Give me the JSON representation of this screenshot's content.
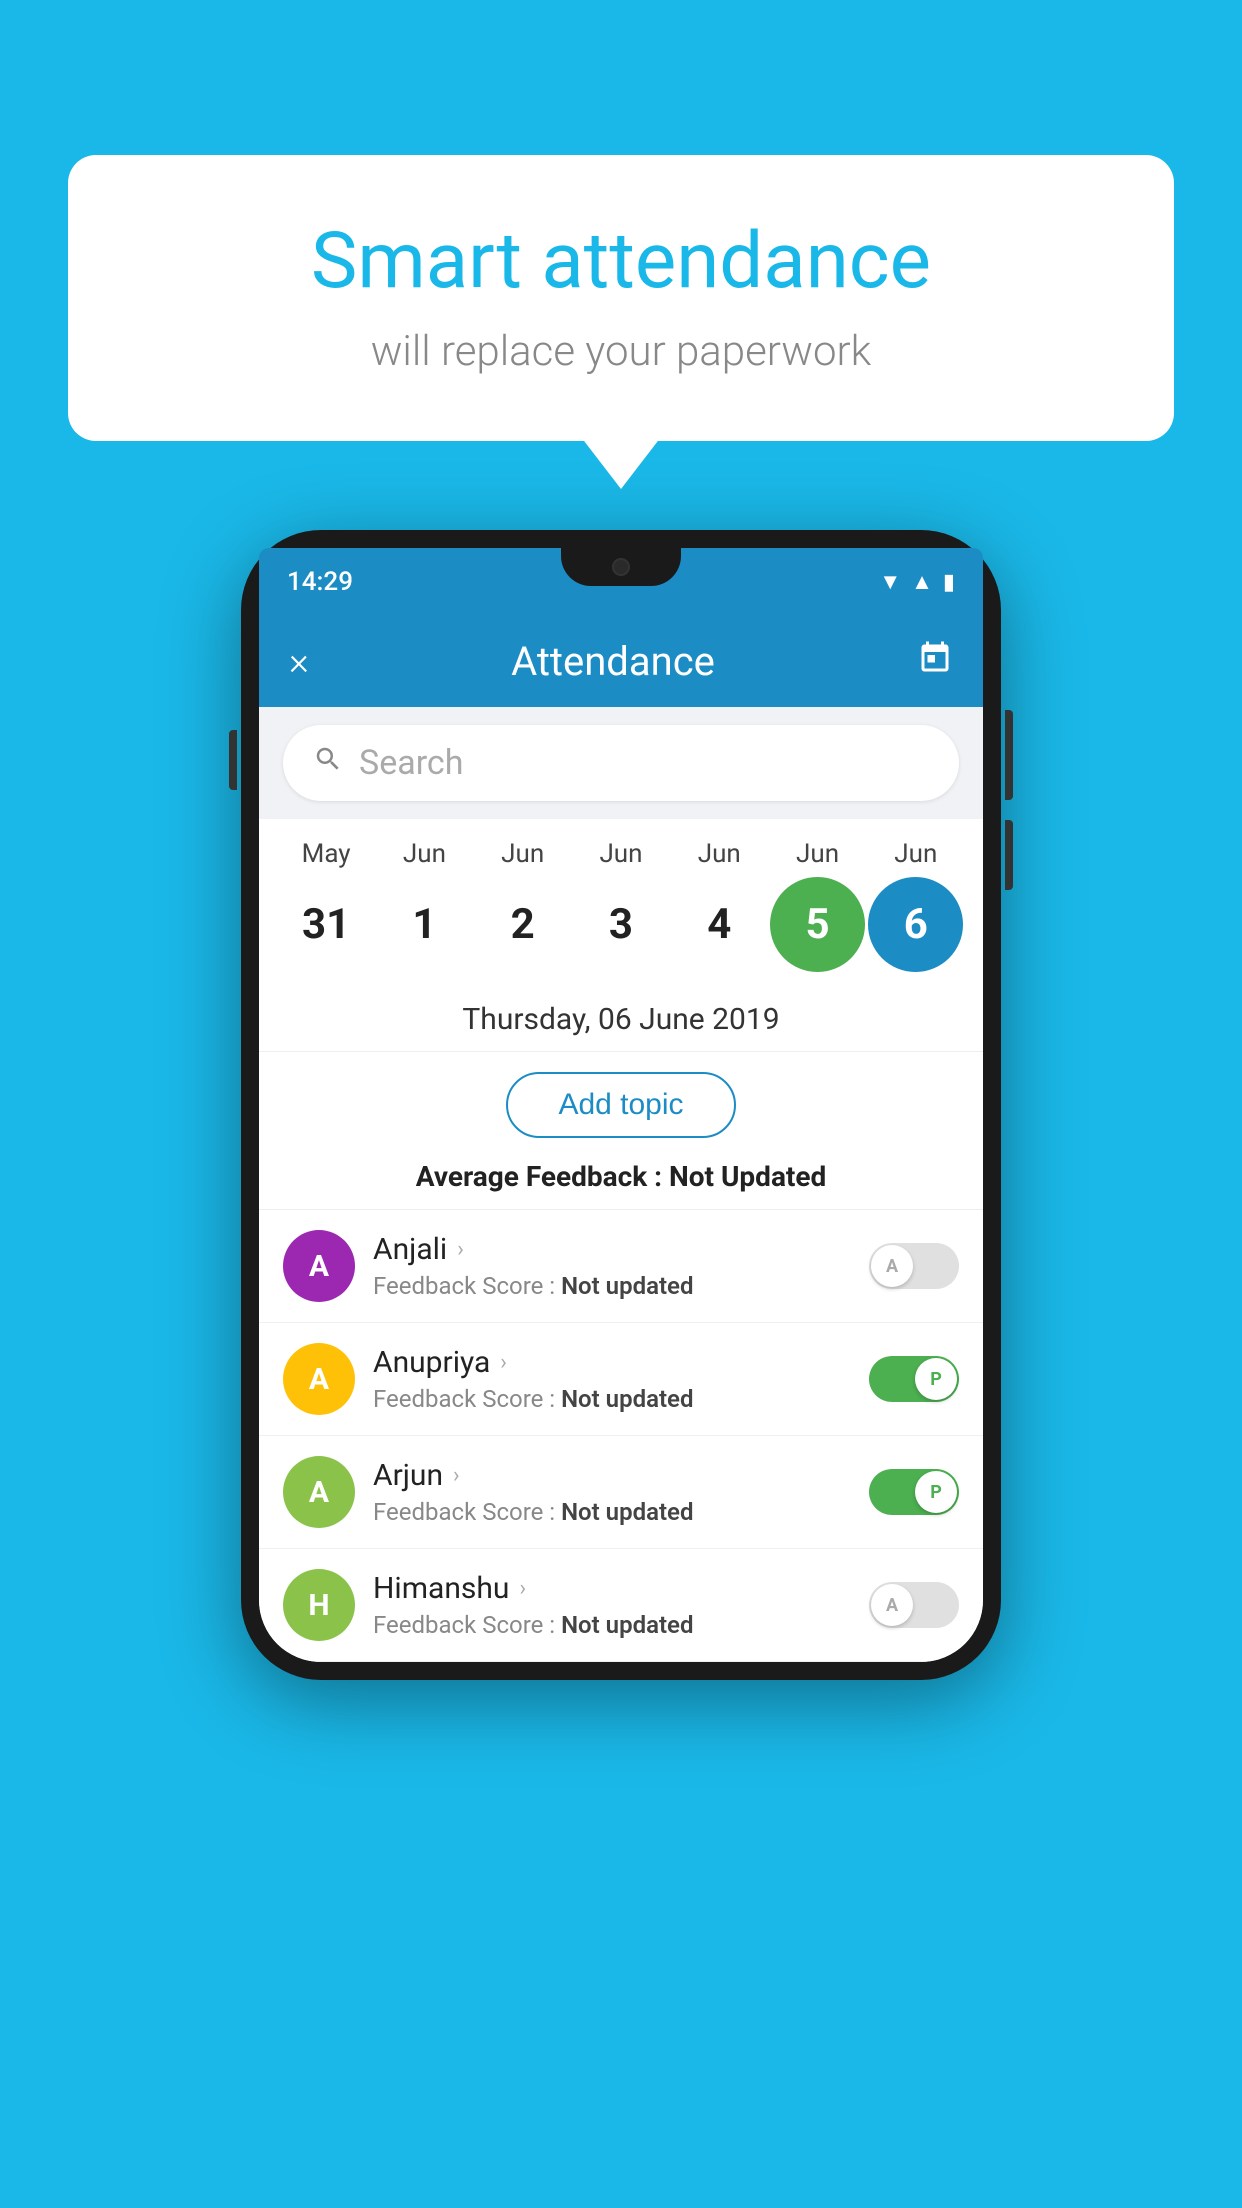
{
  "background_color": "#1ab8e8",
  "bubble": {
    "title": "Smart attendance",
    "subtitle": "will replace your paperwork"
  },
  "phone": {
    "status_bar": {
      "time": "14:29"
    },
    "header": {
      "title": "Attendance",
      "close_label": "×",
      "calendar_icon": "calendar-icon"
    },
    "search": {
      "placeholder": "Search"
    },
    "calendar": {
      "months": [
        "May",
        "Jun",
        "Jun",
        "Jun",
        "Jun",
        "Jun",
        "Jun"
      ],
      "dates": [
        "31",
        "1",
        "2",
        "3",
        "4",
        "5",
        "6"
      ],
      "today_index": 5,
      "selected_index": 6
    },
    "selected_date": "Thursday, 06 June 2019",
    "add_topic_label": "Add topic",
    "avg_feedback_label": "Average Feedback :",
    "avg_feedback_value": "Not Updated",
    "students": [
      {
        "name": "Anjali",
        "avatar_letter": "A",
        "avatar_color": "#9c27b0",
        "feedback_label": "Feedback Score :",
        "feedback_value": "Not updated",
        "attendance": "absent"
      },
      {
        "name": "Anupriya",
        "avatar_letter": "A",
        "avatar_color": "#ffc107",
        "feedback_label": "Feedback Score :",
        "feedback_value": "Not updated",
        "attendance": "present"
      },
      {
        "name": "Arjun",
        "avatar_letter": "A",
        "avatar_color": "#8bc34a",
        "feedback_label": "Feedback Score :",
        "feedback_value": "Not updated",
        "attendance": "present"
      },
      {
        "name": "Himanshu",
        "avatar_letter": "H",
        "avatar_color": "#8bc34a",
        "feedback_label": "Feedback Score :",
        "feedback_value": "Not updated",
        "attendance": "absent"
      }
    ]
  }
}
